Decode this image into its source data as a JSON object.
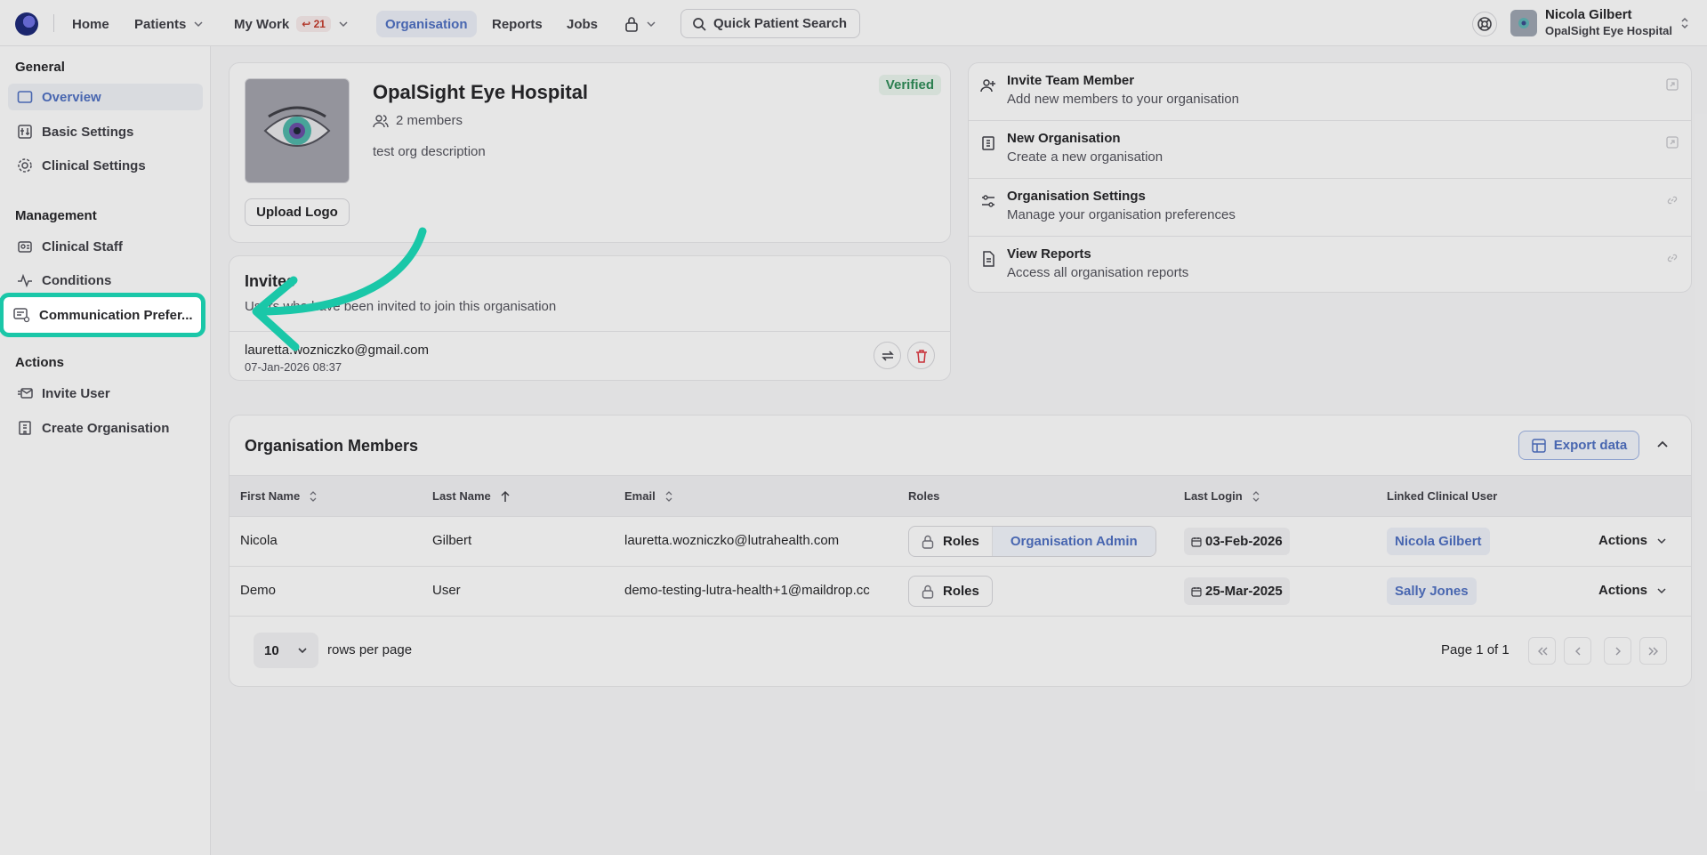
{
  "topnav": {
    "home": "Home",
    "patients": "Patients",
    "my_work": "My Work",
    "my_work_count": "21",
    "organisation": "Organisation",
    "reports": "Reports",
    "jobs": "Jobs",
    "search_label": "Quick Patient Search",
    "user_name": "Nicola Gilbert",
    "user_org": "OpalSight Eye Hospital"
  },
  "sidebar": {
    "general_heading": "General",
    "general_items": [
      "Overview",
      "Basic Settings",
      "Clinical Settings"
    ],
    "management_heading": "Management",
    "management_items": [
      "Clinical Staff",
      "Conditions",
      "Communication Prefer..."
    ],
    "actions_heading": "Actions",
    "actions_items": [
      "Invite User",
      "Create Organisation"
    ]
  },
  "org": {
    "name": "OpalSight Eye Hospital",
    "members": "2 members",
    "description": "test org description",
    "status": "Verified",
    "upload_label": "Upload Logo"
  },
  "invites": {
    "title": "Invites",
    "subtitle": "Users who have been invited to join this organisation",
    "items": [
      {
        "email": "lauretta.wozniczko@gmail.com",
        "date": "07-Jan-2026 08:37"
      }
    ]
  },
  "quick_actions": [
    {
      "title": "Invite Team Member",
      "desc": "Add new members to your organisation"
    },
    {
      "title": "New Organisation",
      "desc": "Create a new organisation"
    },
    {
      "title": "Organisation Settings",
      "desc": "Manage your organisation preferences"
    },
    {
      "title": "View Reports",
      "desc": "Access all organisation reports"
    }
  ],
  "members": {
    "title": "Organisation Members",
    "export_label": "Export data",
    "columns": [
      "First Name",
      "Last Name",
      "Email",
      "Roles",
      "Last Login",
      "Linked Clinical User"
    ],
    "rows": [
      {
        "first": "Nicola",
        "last": "Gilbert",
        "email": "lauretta.wozniczko@lutrahealth.com",
        "roles_label": "Roles",
        "role": "Organisation Admin",
        "last_login": "03-Feb-2026",
        "linked": "Nicola Gilbert",
        "actions": "Actions"
      },
      {
        "first": "Demo",
        "last": "User",
        "email": "demo-testing-lutra-health+1@maildrop.cc",
        "roles_label": "Roles",
        "role": "",
        "last_login": "25-Mar-2025",
        "linked": "Sally Jones",
        "actions": "Actions"
      }
    ],
    "rows_per_page": "10",
    "rows_per_page_label": "rows per page",
    "page_info": "Page 1 of 1"
  },
  "colors": {
    "accent": "#4f6fbf",
    "highlight": "#1ac7a8",
    "verified": "#2f8a57",
    "danger": "#d9363e"
  }
}
